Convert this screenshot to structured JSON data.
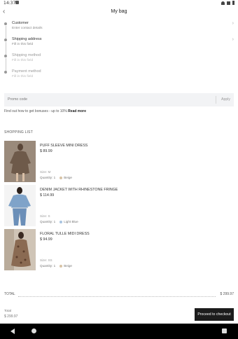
{
  "status_bar": {
    "time": "14:37"
  },
  "header": {
    "title": "My bag",
    "back_icon": "back-arrow-icon"
  },
  "steps": [
    {
      "title": "Customer",
      "subtitle": "Enter contact details"
    },
    {
      "title": "Shipping address",
      "subtitle": "Fill in this field"
    },
    {
      "title": "Shipping method",
      "subtitle": "Fill in this field"
    },
    {
      "title": "Payment method",
      "subtitle": "Fill in this field"
    }
  ],
  "promo": {
    "placeholder": "Promo code",
    "apply_label": "Apply"
  },
  "bonus": {
    "text": "Find out how to get bonuses - up to 10%",
    "link": "Read more"
  },
  "shopping_list": {
    "title": "SHOPPING LIST",
    "items": [
      {
        "name": "PUFF SLEEVE MINI DRESS",
        "price": "$ 89.99",
        "size": "Size: M",
        "qty": "Quantity: 1",
        "color": "Beige",
        "color_hex": "#d8c3a5"
      },
      {
        "name": "DENIM JACKET WITH RHINESTONE FRINGE",
        "price": "$ 114.99",
        "size": "Size: S",
        "qty": "Quantity: 1",
        "color": "Light Blue",
        "color_hex": "#a9c4e0"
      },
      {
        "name": "FLORAL TULLE MIDI DRESS",
        "price": "$ 94.99",
        "size": "Size: XS",
        "qty": "Quantity: 1",
        "color": "Beige",
        "color_hex": "#d8c3a5"
      }
    ]
  },
  "total": {
    "label": "TOTAL",
    "amount": "$ 299.97"
  },
  "footer": {
    "total_label": "Total",
    "total_value": "$ 299.97",
    "checkout_label": "Proceed to checkout"
  }
}
